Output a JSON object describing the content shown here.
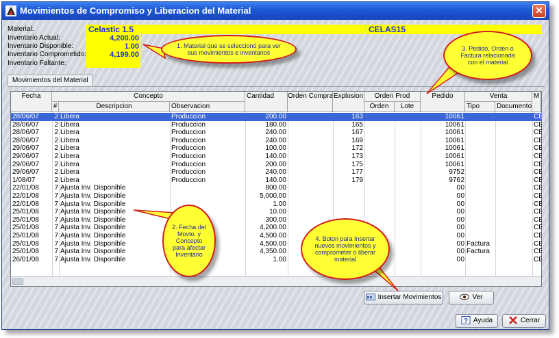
{
  "window": {
    "title": "Movimientos de Compromiso y Liberacion del Material"
  },
  "header": {
    "material_label": "Material:",
    "material_value": "Celastic 1.5",
    "material_code": "CELAS15",
    "actual_label": "Inventario Actual:",
    "actual_value": "4,200.00",
    "disponible_label": "Inventario Disponible:",
    "disponible_value": "1.00",
    "comprometido_label": "Inventario Comprometido:",
    "comprometido_value": "4,199.00",
    "faltante_label": "Inventario Faltante:"
  },
  "tab": {
    "label": "Movimientos del Material"
  },
  "grid": {
    "headers": {
      "fecha": "Fecha",
      "concepto": "Concepto",
      "num": "#",
      "descripcion": "Descripcion",
      "observacion": "Observacion",
      "cantidad": "Cantidad",
      "orden_compra": "Orden Compra",
      "explosion": "Explosion",
      "orden_prod": "Orden Prod",
      "orden": "Orden",
      "lote": "Lote",
      "pedido": "Pedido",
      "venta": "Venta",
      "tipo": "Tipo",
      "documento": "Documento",
      "m": "M"
    },
    "rows": [
      {
        "fecha": "28/06/07",
        "num": "2",
        "desc": "Libera",
        "obs": "Produccion",
        "cant": "200.00",
        "expl": "163",
        "pedido": "1006",
        "p2": "1",
        "tipo": "",
        "m": "CE"
      },
      {
        "fecha": "28/06/07",
        "num": "2",
        "desc": "Libera",
        "obs": "Produccion",
        "cant": "180.00",
        "expl": "165",
        "pedido": "1006",
        "p2": "1",
        "tipo": "",
        "m": "CE"
      },
      {
        "fecha": "28/06/07",
        "num": "2",
        "desc": "Libera",
        "obs": "Produccion",
        "cant": "240.00",
        "expl": "167",
        "pedido": "1006",
        "p2": "1",
        "tipo": "",
        "m": "CE"
      },
      {
        "fecha": "28/06/07",
        "num": "2",
        "desc": "Libera",
        "obs": "Produccion",
        "cant": "240.00",
        "expl": "169",
        "pedido": "1006",
        "p2": "1",
        "tipo": "",
        "m": "CE"
      },
      {
        "fecha": "29/06/07",
        "num": "2",
        "desc": "Libera",
        "obs": "Produccion",
        "cant": "100.00",
        "expl": "172",
        "pedido": "1006",
        "p2": "1",
        "tipo": "",
        "m": "CE"
      },
      {
        "fecha": "29/06/07",
        "num": "2",
        "desc": "Libera",
        "obs": "Produccion",
        "cant": "140.00",
        "expl": "173",
        "pedido": "1006",
        "p2": "1",
        "tipo": "",
        "m": "CE"
      },
      {
        "fecha": "29/06/07",
        "num": "2",
        "desc": "Libera",
        "obs": "Produccion",
        "cant": "200.00",
        "expl": "175",
        "pedido": "1006",
        "p2": "1",
        "tipo": "",
        "m": "CE"
      },
      {
        "fecha": "29/06/07",
        "num": "2",
        "desc": "Libera",
        "obs": "Produccion",
        "cant": "240.00",
        "expl": "177",
        "pedido": "975",
        "p2": "2",
        "tipo": "",
        "m": "CE"
      },
      {
        "fecha": "1/08/07",
        "num": "2",
        "desc": "Libera",
        "obs": "Produccion",
        "cant": "140.00",
        "expl": "179",
        "pedido": "976",
        "p2": "2",
        "tipo": "",
        "m": "CE"
      },
      {
        "fecha": "22/01/08",
        "num": "7",
        "desc": "Ajusta Inv. Disponible",
        "obs": "",
        "cant": "800.00",
        "expl": "",
        "pedido": "0",
        "p2": "0",
        "tipo": "",
        "m": "CE"
      },
      {
        "fecha": "22/01/08",
        "num": "7",
        "desc": "Ajusta Inv. Disponible",
        "obs": "",
        "cant": "5,000.00",
        "expl": "",
        "pedido": "0",
        "p2": "0",
        "tipo": "",
        "m": "CE"
      },
      {
        "fecha": "22/01/08",
        "num": "7",
        "desc": "Ajusta Inv. Disponible",
        "obs": "",
        "cant": "1.00",
        "expl": "",
        "pedido": "0",
        "p2": "0",
        "tipo": "",
        "m": "CE"
      },
      {
        "fecha": "25/01/08",
        "num": "7",
        "desc": "Ajusta Inv. Disponible",
        "obs": "",
        "cant": "10.00",
        "expl": "",
        "pedido": "0",
        "p2": "0",
        "tipo": "",
        "m": "CE"
      },
      {
        "fecha": "25/01/08",
        "num": "7",
        "desc": "Ajusta Inv. Disponible",
        "obs": "",
        "cant": "300.00",
        "expl": "",
        "pedido": "0",
        "p2": "0",
        "tipo": "",
        "m": "CE"
      },
      {
        "fecha": "25/01/08",
        "num": "7",
        "desc": "Ajusta Inv. Disponible",
        "obs": "",
        "cant": "4,200.00",
        "expl": "",
        "pedido": "0",
        "p2": "0",
        "tipo": "",
        "m": "CE"
      },
      {
        "fecha": "25/01/08",
        "num": "7",
        "desc": "Ajusta Inv. Disponible",
        "obs": "",
        "cant": "4,500.00",
        "expl": "",
        "pedido": "0",
        "p2": "0",
        "tipo": "",
        "m": "CE"
      },
      {
        "fecha": "25/01/08",
        "num": "7",
        "desc": "Ajusta Inv. Disponible",
        "obs": "",
        "cant": "4,500.00",
        "expl": "",
        "pedido": "0",
        "p2": "0",
        "tipo": "Factura",
        "m": "CE"
      },
      {
        "fecha": "25/01/08",
        "num": "7",
        "desc": "Ajusta Inv. Disponible",
        "obs": "",
        "cant": "4,350.00",
        "expl": "",
        "pedido": "0",
        "p2": "0",
        "tipo": "Factura",
        "m": "CE"
      },
      {
        "fecha": "26/01/08",
        "num": "7",
        "desc": "Ajusta Inv. Disponible",
        "obs": "",
        "cant": "1.00",
        "expl": "",
        "pedido": "0",
        "p2": "0",
        "tipo": "",
        "m": "CE"
      }
    ]
  },
  "buttons": {
    "insertar": "Insertar Movimientos",
    "ver": "Ver",
    "ayuda": "Ayuda",
    "cerrar": "Cerrar"
  },
  "callouts": {
    "c1": "1. Material que se seleccionó para ver sus movimientos e inventarios",
    "c2": "2. Fecha del Movto. y Concepto para afectar Inventario",
    "c3": "3. Pedido, Orden o Factura relacionada con el material",
    "c4": "4. Boton para Insertar nuevos movimientos y comprometer o liberar material"
  },
  "colors": {
    "title_bar": "#1f5ad6",
    "highlight_yellow": "#ffff00",
    "header_text_blue": "#1c2fd6",
    "selection": "#3a66d6",
    "callout_border": "#d21d1d"
  }
}
